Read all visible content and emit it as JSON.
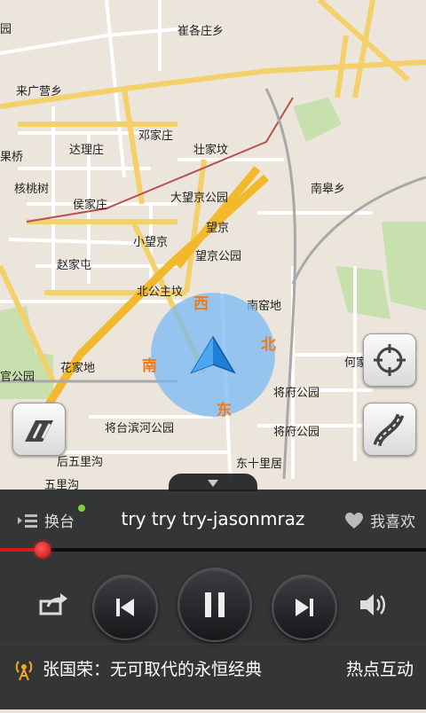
{
  "map": {
    "places": [
      "崔各庄乡",
      "来广营乡",
      "邓家庄",
      "达理庄",
      "壮家坟",
      "果桥",
      "核桃树",
      "侯家庄",
      "大望京公园",
      "南皋乡",
      "望京",
      "小望京",
      "赵家屯",
      "望京公园",
      "北公主坟",
      "南窑地",
      "花家地",
      "何家",
      "官公园",
      "将府公园",
      "将台滨河公园",
      "将府公园",
      "后五里沟",
      "东十里居",
      "五里沟",
      "园"
    ],
    "directions": [
      "西",
      "北",
      "南",
      "东"
    ]
  },
  "colors": {
    "location_blue": "#2a8de0",
    "accent_red": "#d31a1a",
    "panel": "#1a1c1e"
  },
  "player": {
    "switch_label": "换台",
    "song_title": "try try try-jasonmraz",
    "like_label": "我喜欢",
    "progress": 0.1,
    "ticker_text": "张国荣：无可取代的永恒经典",
    "hot_label": "热点互动"
  }
}
